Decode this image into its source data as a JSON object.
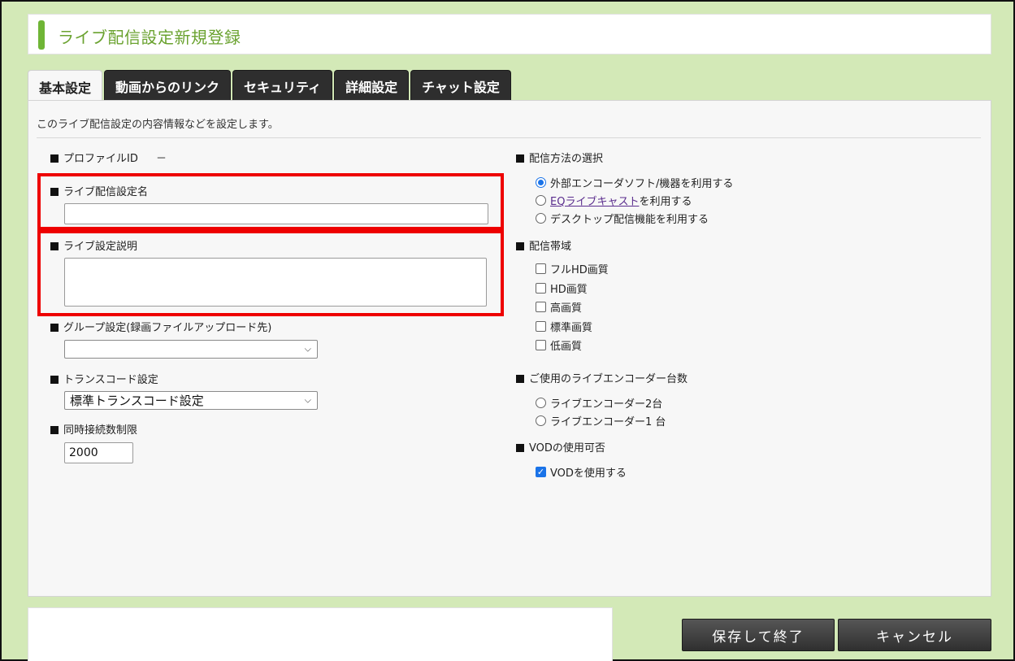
{
  "page": {
    "title": "ライブ配信設定新規登録"
  },
  "tabs": [
    {
      "label": "基本設定",
      "active": true
    },
    {
      "label": "動画からのリンク"
    },
    {
      "label": "セキュリティ"
    },
    {
      "label": "詳細設定"
    },
    {
      "label": "チャット設定"
    }
  ],
  "intro": "このライブ配信設定の内容情報などを設定します。",
  "left": {
    "profile_label": "プロファイルID",
    "profile_value": "－",
    "name_label": "ライブ配信設定名",
    "name_value": "",
    "desc_label": "ライブ設定説明",
    "desc_value": "",
    "group_label": "グループ設定(録画ファイルアップロード先)",
    "group_value": "",
    "transcode_label": "トランスコード設定",
    "transcode_value": "標準トランスコード設定",
    "limit_label": "同時接続数制限",
    "limit_value": "2000"
  },
  "right": {
    "method_label": "配信方法の選択",
    "method_options": [
      {
        "label": "外部エンコーダソフト/機器を利用する",
        "selected": true
      },
      {
        "link": "EQライブキャスト",
        "suffix": "を利用する",
        "selected": false
      },
      {
        "label": "デスクトップ配信機能を利用する",
        "selected": false
      }
    ],
    "bandwidth_label": "配信帯域",
    "bandwidth_options": [
      {
        "label": "フルHD画質",
        "checked": false
      },
      {
        "label": "HD画質",
        "checked": false
      },
      {
        "label": "高画質",
        "checked": false
      },
      {
        "label": "標準画質",
        "checked": false
      },
      {
        "label": "低画質",
        "checked": false
      }
    ],
    "encoder_label": "ご使用のライブエンコーダー台数",
    "encoder_options": [
      {
        "label": "ライブエンコーダー2台",
        "selected": false
      },
      {
        "label": "ライブエンコーダー1 台",
        "selected": false
      }
    ],
    "vod_label": "VODの使用可否",
    "vod_option": {
      "label": "VODを使用する",
      "checked": true
    }
  },
  "buttons": {
    "save": "保存して終了",
    "cancel": "キャンセル"
  },
  "colors": {
    "background": "#d3e9b7",
    "accent": "#6fb536",
    "highlight": "#ee0000",
    "control": "#1a73e8"
  }
}
